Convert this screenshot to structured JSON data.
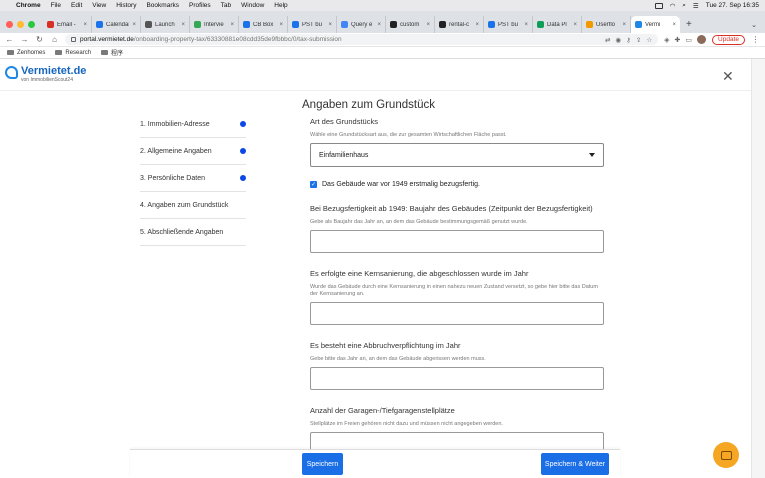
{
  "menubar": {
    "apple": "",
    "items": [
      "Chrome",
      "File",
      "Edit",
      "View",
      "History",
      "Bookmarks",
      "Profiles",
      "Tab",
      "Window",
      "Help"
    ],
    "clock": "Tue 27. Sep 16:35"
  },
  "tabs": [
    {
      "label": "Email -",
      "color": "#d93025"
    },
    {
      "label": "Calendar",
      "color": "#1a73e8"
    },
    {
      "label": "Launch",
      "color": "#555555"
    },
    {
      "label": "Intervie",
      "color": "#34a853"
    },
    {
      "label": "CB Box",
      "color": "#1a73e8"
    },
    {
      "label": "PST bu",
      "color": "#1a73e8"
    },
    {
      "label": "Query e",
      "color": "#4285f4"
    },
    {
      "label": "custom",
      "color": "#222222"
    },
    {
      "label": "rental-c",
      "color": "#222222"
    },
    {
      "label": "PST bu",
      "color": "#1a73e8"
    },
    {
      "label": "Data Pl",
      "color": "#0f9d58"
    },
    {
      "label": "Userflo",
      "color": "#f29900"
    },
    {
      "label": "Vermi",
      "color": "#1e88e5",
      "active": true
    }
  ],
  "tab_close": "×",
  "new_tab": "+",
  "address": {
    "host": "portal.vermietet.de",
    "path": "/onboarding-property-tax/63330881e08cdd35de9fbbbc/0/tax-submission"
  },
  "update_label": "Update",
  "bookmarks": [
    "Zenhomes",
    "Research",
    "程序"
  ],
  "site": {
    "brand": "Vermietet.de",
    "brand_sub": "von ImmobilienScout24",
    "close": "✕"
  },
  "steps": [
    {
      "label": "1. Immobilien-Adresse",
      "done": true
    },
    {
      "label": "2. Allgemeine Angaben",
      "done": true
    },
    {
      "label": "3. Persönliche Daten",
      "done": true
    },
    {
      "label": "4. Angaben zum Grundstück",
      "done": false
    },
    {
      "label": "5. Abschließende Angaben",
      "done": false
    }
  ],
  "form": {
    "title": "Angaben zum Grundstück",
    "art": {
      "label": "Art des Grundstücks",
      "hint": "Wähle eine Grundstücksart aus, die zur gesamten Wirtschaftlichen Fläche passt.",
      "value": "Einfamilienhaus"
    },
    "checkbox_label": "Das Gebäude war vor 1949 erstmalig bezugsfertig.",
    "baujahr": {
      "label": "Bei Bezugsfertigkeit ab 1949: Baujahr des Gebäudes (Zeitpunkt der Bezugsfertigkeit)",
      "hint": "Gebe als Baujahr das Jahr an, an dem das Gebäude bestimmungsgemäß genutzt wurde."
    },
    "kernsanierung": {
      "label": "Es erfolgte eine Kernsanierung, die abgeschlossen wurde im Jahr",
      "hint": "Wurde das Gebäude durch eine Kernsanierung in einen nahezu neuen Zustand versetzt, so gebe hier bitte das Datum der Kernsanierung an."
    },
    "abbruch": {
      "label": "Es besteht eine Abbruchverpflichtung im Jahr",
      "hint": "Gebe bitte das Jahr an, an dem das Gebäude abgerissen werden muss."
    },
    "garagen": {
      "label": "Anzahl der Garagen-/Tiefgaragenstellplätze",
      "hint": "Stellplätze im Freien gehören nicht dazu und müssen nicht angegeben werden."
    }
  },
  "footer": {
    "save": "Speichern",
    "save_next": "Speichern & Weiter"
  },
  "colors": {
    "primary": "#1a6ee6",
    "step_dot": "#0d47e8",
    "chat": "#f5a623"
  }
}
